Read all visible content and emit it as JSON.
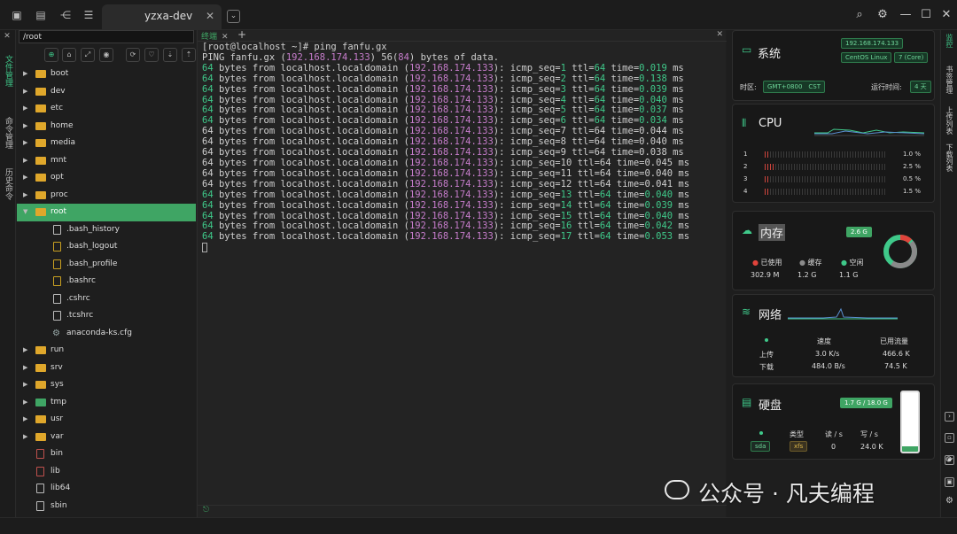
{
  "window": {
    "tab_title": "yzxa-dev",
    "tab_close": "✕",
    "tab_menu": "⌄",
    "top_icons": [
      "terminal-icon",
      "file-icon",
      "share-icon",
      "list-icon"
    ],
    "actions": [
      "search-icon",
      "settings-icon",
      "minimize-icon",
      "maximize-icon",
      "close-icon"
    ]
  },
  "left_sidebar": {
    "close": "✕",
    "items": [
      "文件管理",
      "命令管理",
      "历史命令"
    ]
  },
  "file_panel": {
    "path": "/root",
    "tools": [
      "⊕",
      "⌂",
      "⤢",
      "◉",
      "⟳",
      "♡",
      "⇣"
    ],
    "tree": [
      {
        "name": "boot",
        "type": "folder",
        "expandable": true
      },
      {
        "name": "dev",
        "type": "folder",
        "expandable": true
      },
      {
        "name": "etc",
        "type": "folder",
        "expandable": true
      },
      {
        "name": "home",
        "type": "folder",
        "expandable": true
      },
      {
        "name": "media",
        "type": "folder",
        "expandable": true
      },
      {
        "name": "mnt",
        "type": "folder",
        "expandable": true
      },
      {
        "name": "opt",
        "type": "folder",
        "expandable": true
      },
      {
        "name": "proc",
        "type": "folder",
        "expandable": true
      },
      {
        "name": "root",
        "type": "folder",
        "expandable": true,
        "selected": true,
        "expanded": true
      },
      {
        "name": ".bash_history",
        "type": "file",
        "indent": 1
      },
      {
        "name": ".bash_logout",
        "type": "file-y",
        "indent": 1
      },
      {
        "name": ".bash_profile",
        "type": "file-y",
        "indent": 1
      },
      {
        "name": ".bashrc",
        "type": "file-y",
        "indent": 1
      },
      {
        "name": ".cshrc",
        "type": "file",
        "indent": 1
      },
      {
        "name": ".tcshrc",
        "type": "file",
        "indent": 1
      },
      {
        "name": "anaconda-ks.cfg",
        "type": "gear",
        "indent": 1
      },
      {
        "name": "run",
        "type": "folder",
        "expandable": true
      },
      {
        "name": "srv",
        "type": "folder",
        "expandable": true
      },
      {
        "name": "sys",
        "type": "folder",
        "expandable": true
      },
      {
        "name": "tmp",
        "type": "folder-green",
        "expandable": true
      },
      {
        "name": "usr",
        "type": "folder",
        "expandable": true
      },
      {
        "name": "var",
        "type": "folder",
        "expandable": true
      },
      {
        "name": "bin",
        "type": "file-r"
      },
      {
        "name": "lib",
        "type": "file-r"
      },
      {
        "name": "lib64",
        "type": "file"
      },
      {
        "name": "sbin",
        "type": "file"
      }
    ]
  },
  "terminal": {
    "tab_label": "终端",
    "tab_close": "✕",
    "new_tab": "+",
    "close_panel": "✕",
    "prompt": "[root@localhost ~]# ping fanfu.gx",
    "ping_header": {
      "pre": "PING fanfu.gx (",
      "ip": "192.168.174.133",
      "mid": ") 56(",
      "bytes": "84",
      "post": ") bytes of data."
    },
    "line_host": "localhost.localdomain",
    "ip": "192.168.174.133",
    "replies": [
      {
        "seq": "1",
        "time": "0.019"
      },
      {
        "seq": "2",
        "time": "0.138"
      },
      {
        "seq": "3",
        "time": "0.039"
      },
      {
        "seq": "4",
        "time": "0.040"
      },
      {
        "seq": "5",
        "time": "0.037"
      },
      {
        "seq": "6",
        "time": "0.034"
      },
      {
        "seq": "7",
        "time": "0.044"
      },
      {
        "seq": "8",
        "time": "0.040"
      },
      {
        "seq": "9",
        "time": "0.038"
      },
      {
        "seq": "10",
        "time": "0.045"
      },
      {
        "seq": "11",
        "time": "0.040"
      },
      {
        "seq": "12",
        "time": "0.041"
      },
      {
        "seq": "13",
        "time": "0.040"
      },
      {
        "seq": "14",
        "time": "0.039"
      },
      {
        "seq": "15",
        "time": "0.040"
      },
      {
        "seq": "16",
        "time": "0.042"
      },
      {
        "seq": "17",
        "time": "0.053"
      }
    ],
    "colored_seqs": [
      1,
      2,
      3,
      4,
      5,
      6,
      13,
      14,
      15,
      16,
      17
    ]
  },
  "monitor": {
    "system": {
      "title": "系统",
      "ip": "192.168.174.133",
      "os": "CentOS Linux",
      "cores": "7 (Core)",
      "tz_label": "时区:",
      "tz_value": "GMT+0800　CST",
      "uptime_label": "运行时间:",
      "uptime_value": "4 天"
    },
    "cpu": {
      "title": "CPU",
      "cores": [
        {
          "id": "1",
          "pct": "1.0 %",
          "usage": 0.01
        },
        {
          "id": "2",
          "pct": "2.5 %",
          "usage": 0.025
        },
        {
          "id": "3",
          "pct": "0.5 %",
          "usage": 0.005
        },
        {
          "id": "4",
          "pct": "1.5 %",
          "usage": 0.015
        }
      ]
    },
    "memory": {
      "title": "内存",
      "total": "2.6 G",
      "legend": [
        {
          "label": "已使用",
          "value": "302.9 M",
          "color": "#e0433b"
        },
        {
          "label": "缓存",
          "value": "1.2 G",
          "color": "#8a8a8a"
        },
        {
          "label": "空闲",
          "value": "1.1 G",
          "color": "#3fc98a"
        }
      ]
    },
    "network": {
      "title": "网络",
      "col_speed": "速度",
      "col_total": "已用流量",
      "up_label": "上传",
      "up_speed": "3.0 K/s",
      "up_total": "466.6 K",
      "down_label": "下载",
      "down_speed": "484.0 B/s",
      "down_total": "74.5 K"
    },
    "disk": {
      "title": "硬盘",
      "usage": "1.7 G / 18.0 G",
      "fill": 0.094,
      "col_type": "类型",
      "col_read": "读 / s",
      "col_write": "写 / s",
      "dev": "sda",
      "type": "xfs",
      "read": "0",
      "write": "24.0 K"
    }
  },
  "right_sidebar": {
    "items": [
      "监控",
      "书签管理",
      "上传列表",
      "下载列表"
    ]
  },
  "watermark": "公众号 · 凡夫编程"
}
